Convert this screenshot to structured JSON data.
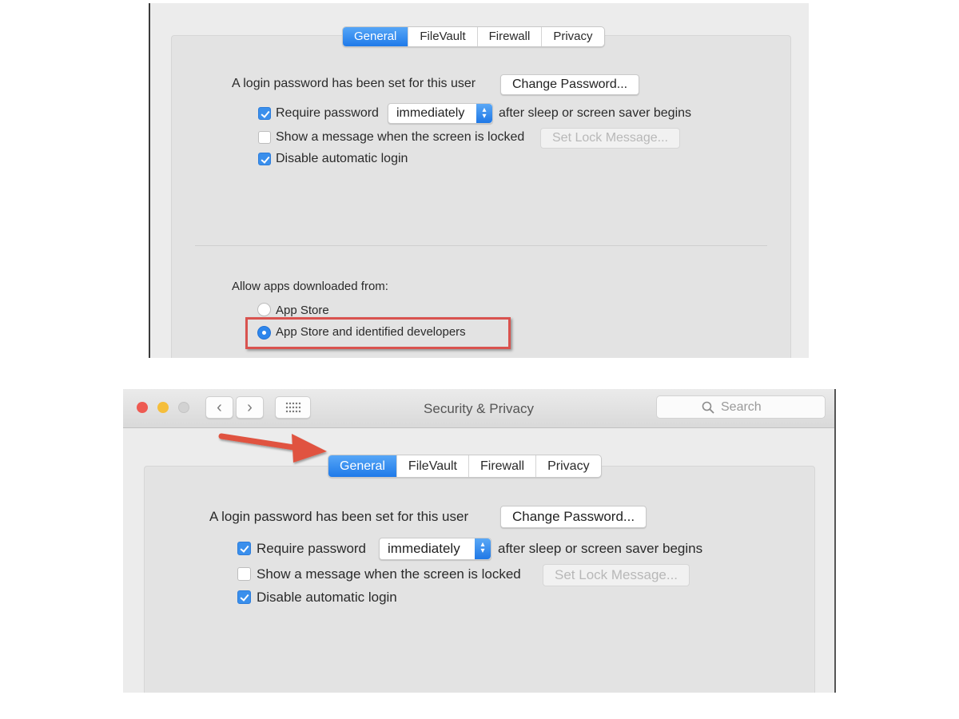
{
  "top_panel": {
    "tabs": [
      {
        "label": "General",
        "active": true
      },
      {
        "label": "FileVault",
        "active": false
      },
      {
        "label": "Firewall",
        "active": false
      },
      {
        "label": "Privacy",
        "active": false
      }
    ],
    "login_password_text": "A login password has been set for this user",
    "change_password_button": "Change Password...",
    "require_password": {
      "label": "Require password",
      "checked": true,
      "select_value": "immediately",
      "suffix": "after sleep or screen saver begins"
    },
    "show_message": {
      "label": "Show a message when the screen is locked",
      "checked": false,
      "button": "Set Lock Message..."
    },
    "disable_auto_login": {
      "label": "Disable automatic login",
      "checked": true
    },
    "allow_apps_label": "Allow apps downloaded from:",
    "radio_options": [
      {
        "label": "App Store",
        "selected": false
      },
      {
        "label": "App Store and identified developers",
        "selected": true
      }
    ],
    "highlight_color": "#d9534f"
  },
  "window": {
    "title": "Security & Privacy",
    "search_placeholder": "Search",
    "traffic_lights": {
      "close": "#ee5a52",
      "minimize": "#f5be3b",
      "zoom": "#cfcfcf"
    },
    "nav": {
      "back": "‹",
      "forward": "›",
      "grid": "grid-icon"
    },
    "tabs": [
      {
        "label": "General",
        "active": true
      },
      {
        "label": "FileVault",
        "active": false
      },
      {
        "label": "Firewall",
        "active": false
      },
      {
        "label": "Privacy",
        "active": false
      }
    ],
    "login_password_text": "A login password has been set for this user",
    "change_password_button": "Change Password...",
    "require_password": {
      "label": "Require password",
      "checked": true,
      "select_value": "immediately",
      "suffix": "after sleep or screen saver begins"
    },
    "show_message": {
      "label": "Show a message when the screen is locked",
      "checked": false,
      "button": "Set Lock Message..."
    },
    "disable_auto_login": {
      "label": "Disable automatic login",
      "checked": true
    },
    "arrow_color": "#e0533f",
    "accent_color": "#1f7ae9"
  }
}
